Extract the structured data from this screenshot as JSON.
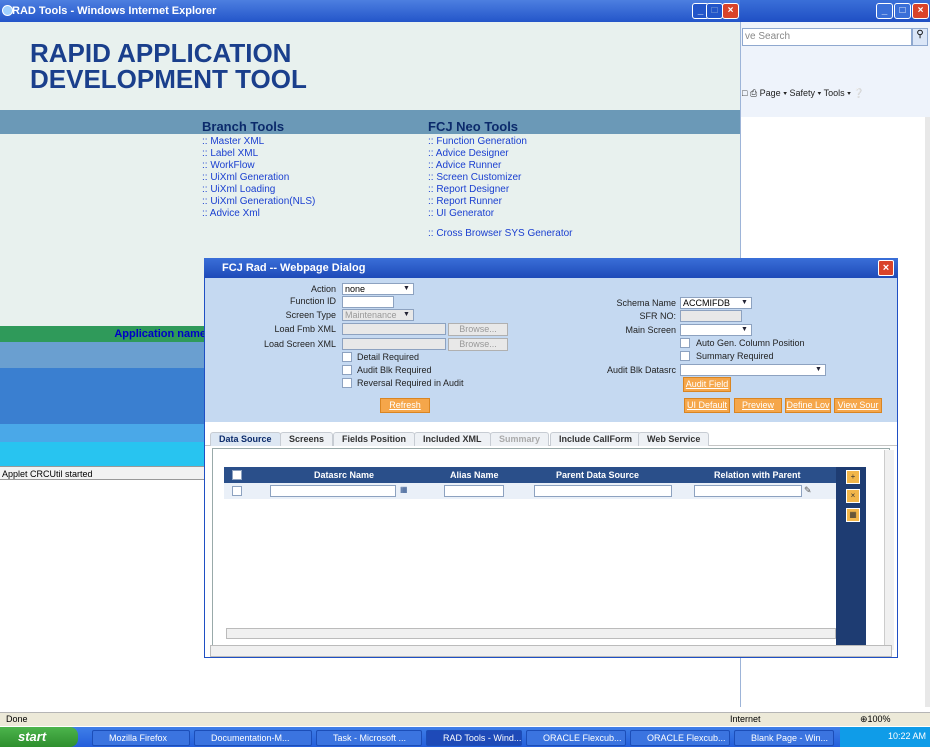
{
  "back_window": {
    "search_placeholder": "ve Search",
    "toolbar": "Page ▾  Safety ▾  Tools ▾"
  },
  "rad": {
    "window_title": "RAD Tools - Windows Internet Explorer",
    "header_line1": "RAPID APPLICATION",
    "header_line2": "DEVELOPMENT TOOL",
    "branch_title": "Branch Tools",
    "branch_links": [
      ":: Master XML",
      ":: Label XML",
      ":: WorkFlow",
      ":: UiXml Generation",
      ":: UiXml Loading",
      ":: UiXml Generation(NLS)",
      ":: Advice Xml"
    ],
    "neo_title": "FCJ Neo Tools",
    "neo_links": [
      ":: Function Generation",
      ":: Advice Designer",
      ":: Advice Runner",
      ":: Screen Customizer",
      ":: Report Designer",
      ":: Report Runner",
      ":: UI Generator",
      ":: Cross Browser SYS Generator"
    ],
    "app_name_label": "Application name",
    "applet_status": "Applet CRCUtil started"
  },
  "dialog": {
    "title": "FCJ Rad -- Webpage Dialog",
    "action_label": "Action",
    "action_value": "none",
    "function_id_label": "Function ID",
    "screen_type_label": "Screen Type",
    "screen_type_value": "Maintenance",
    "load_fmb_label": "Load Fmb XML",
    "load_screen_label": "Load Screen XML",
    "browse_label": "Browse...",
    "detail_required": "Detail Required",
    "audit_blk_required": "Audit Blk Required",
    "reversal_required": "Reversal Required in Audit",
    "refresh_btn": "Refresh",
    "schema_name_label": "Schema Name",
    "schema_name_value": "ACCMIFDB",
    "sfr_no_label": "SFR NO:",
    "main_screen_label": "Main Screen",
    "auto_gen_label": "Auto Gen. Column Position",
    "summary_required": "Summary Required",
    "audit_blk_datasrc_label": "Audit Blk Datasrc",
    "audit_field_btn": "Audit Field",
    "ui_default_btn": "UI Default",
    "preview_btn": "Preview",
    "define_lov_btn": "Define Lov",
    "view_source_btn": "View Sour",
    "tabs": [
      "Data Source",
      "Screens",
      "Fields Position",
      "Included XML",
      "Summary",
      "Include CallForm",
      "Web Service"
    ],
    "grid_headers": [
      "Datasrc Name",
      "Alias Name",
      "Parent Data Source",
      "Relation with Parent"
    ]
  },
  "status": {
    "left": "Done",
    "zone": "Internet",
    "zoom": "⊕100%"
  },
  "taskbar": {
    "start": "start",
    "items": [
      "Mozilla Firefox",
      "Documentation-M...",
      "Task - Microsoft ...",
      "RAD Tools - Wind...",
      "ORACLE Flexcub...",
      "ORACLE Flexcub...",
      "Blank Page - Win..."
    ],
    "clock": "10:22 AM"
  },
  "colors": {
    "accent": "#1a3f8c",
    "band": "#6b99b7",
    "dialog_form": "#c5d9f1",
    "button": "#f5a64a"
  }
}
